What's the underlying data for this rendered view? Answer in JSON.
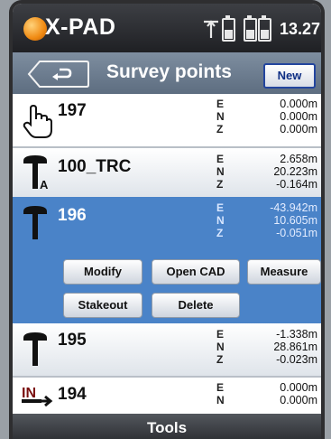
{
  "status_bar": {
    "app_name": "X-PAD",
    "time": "13.27",
    "icons": [
      "xpad-logo-icon",
      "gps-signal-icon",
      "battery-icon",
      "battery-icon",
      "battery-icon"
    ]
  },
  "title_bar": {
    "back_icon": "back-arrow-icon",
    "title": "Survey points",
    "new_label": "New"
  },
  "axis_labels": [
    "E",
    "N",
    "Z"
  ],
  "points": [
    {
      "name": "197",
      "icon": "hand-pointer-icon",
      "values": [
        "0.000m",
        "0.000m",
        "0.000m"
      ],
      "selected": false
    },
    {
      "name": "100_TRC",
      "icon": "gps-pole-antenna-icon",
      "values": [
        "2.658m",
        "20.223m",
        "-0.164m"
      ],
      "selected": false
    },
    {
      "name": "196",
      "icon": "gps-pole-icon",
      "values": [
        "-43.942m",
        "10.605m",
        "-0.051m"
      ],
      "selected": true
    },
    {
      "name": "195",
      "icon": "gps-pole-icon",
      "values": [
        "-1.338m",
        "28.861m",
        "-0.023m"
      ],
      "selected": false
    },
    {
      "name": "194",
      "icon": "import-icon",
      "values": [
        "0.000m",
        "0.000m",
        ""
      ],
      "selected": false
    }
  ],
  "actions": {
    "modify": "Modify",
    "open_cad": "Open CAD",
    "measure": "Measure",
    "stakeout": "Stakeout",
    "delete": "Delete"
  },
  "footer": {
    "tools_label": "Tools"
  },
  "colors": {
    "selection": "#4a83c8",
    "accent": "#f08a12",
    "new_button": "#0e2f84"
  }
}
